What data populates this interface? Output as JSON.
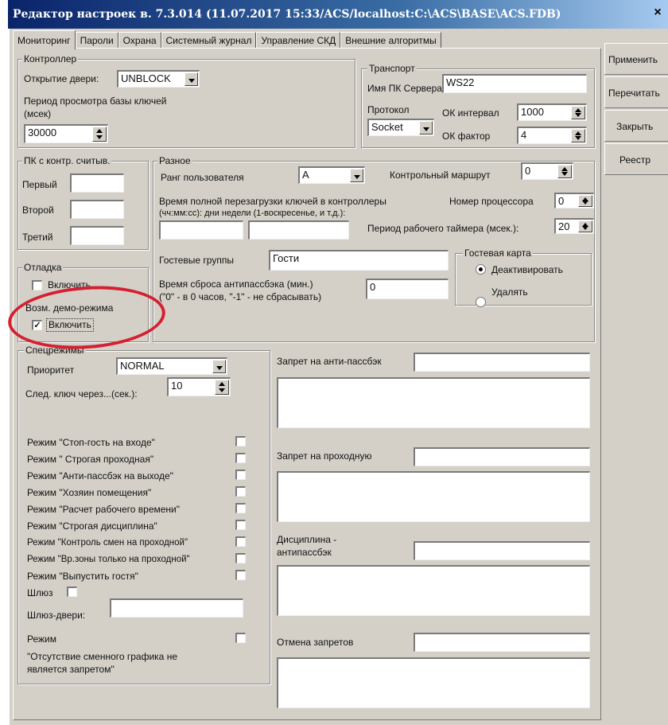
{
  "window": {
    "title": "Редактор настроек в. 7.3.014 (11.07.2017 15:33/ACS/localhost:C:\\ACS\\BASE\\ACS.FDB)",
    "close": "×"
  },
  "tabs": [
    {
      "label": "Мониторинг",
      "active": true
    },
    {
      "label": "Пароли"
    },
    {
      "label": "Охрана"
    },
    {
      "label": "Системный журнал"
    },
    {
      "label": "Управление СКД"
    },
    {
      "label": "Внешние алгоритмы"
    }
  ],
  "side_buttons": [
    "Применить",
    "Перечитать",
    "Закрыть",
    "Реестр"
  ],
  "controller": {
    "title": "Контроллер",
    "door_label": "Открытие двери:",
    "door_value": "UNBLOCK",
    "period_label_1": "Период просмотра базы ключей",
    "period_label_2": "(мсек)",
    "period_value": "30000"
  },
  "transport": {
    "title": "Транспорт",
    "server_label": "Имя ПК Сервера",
    "server_value": "WS22",
    "protocol_label": "Протокол",
    "protocol_value": "Socket",
    "ok_interval_label": "ОК интервал",
    "ok_interval_value": "1000",
    "ok_factor_label": "ОК фактор",
    "ok_factor_value": "4"
  },
  "readers": {
    "title": "ПК с контр. считыв.",
    "first": "Первый",
    "second": "Второй",
    "third": "Третий"
  },
  "misc": {
    "title": "Разное",
    "rank_label": "Ранг пользователя",
    "rank_value": "A",
    "route_label": "Контрольный маршрут",
    "route_value": "0",
    "reload_label_1": "Время полной перезагрузки ключей в контроллеры",
    "reload_label_2": "(чч:мм:сс):     дни недели (1-воскресенье, и т.д.):",
    "cpu_label": "Номер процессора",
    "cpu_value": "0",
    "timer_label": "Период рабочего таймера (мсек.):",
    "timer_value": "20",
    "guest_groups_label": "Гостевые группы",
    "guest_groups_value": "Гости",
    "antipass_label_1": "Время сброса антипассбэка (мин.)",
    "antipass_label_2": "(\"0\" - в 0 часов, \"-1\" - не сбрасывать)",
    "antipass_value": "0"
  },
  "guest_card": {
    "title": "Гостевая карта",
    "option_1": "Деактивировать",
    "option_2": "Удалять"
  },
  "debug": {
    "title": "Отладка",
    "enable": "Включить"
  },
  "demo": {
    "title": "Возм. демо-режима",
    "enable": "Включить"
  },
  "special": {
    "title": "Спецрежимы",
    "priority_label": "Приоритет",
    "priority_value": "NORMAL",
    "next_key_label": "След. ключ через...(сек.):",
    "next_key_value": "10",
    "modes": [
      "Режим \"Стоп-гость на входе\"",
      "Режим \" Строгая проходная\"",
      "Режим \"Анти-пассбэк на выходе\"",
      "Режим \"Хозяин помещения\"",
      "Режим \"Расчет рабочего времени\"",
      "Режим \"Строгая дисциплина\"",
      "Режим \"Контроль смен на проходной\"",
      "Режим \"Вр.зоны только на проходной\"",
      "Режим \"Выпустить гостя\""
    ],
    "gateway_label": "Шлюз",
    "gateway_doors_label": "Шлюз-двери:",
    "mode_label": "Режим",
    "no_schedule_1": "\"Отсутствие сменного графика не",
    "no_schedule_2": "является запретом\""
  },
  "restrictions": {
    "antipass": "Запрет на анти-пассбэк",
    "checkpoint": "Запрет на проходную",
    "discipline_1": "Дисциплина -",
    "discipline_2": "антипассбэк",
    "cancel": "Отмена запретов"
  },
  "colors": {
    "face": "#d4d0c8",
    "title_start": "#0a246a",
    "title_end": "#a6caf0",
    "annotation": "#d42030"
  }
}
